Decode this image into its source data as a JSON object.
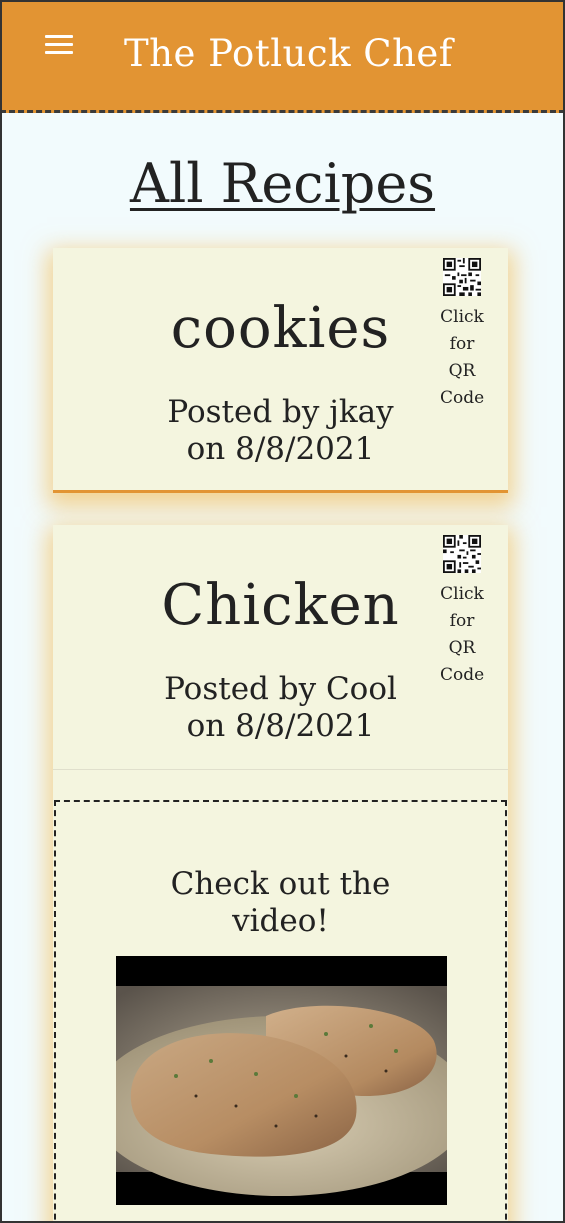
{
  "navbar": {
    "brand": "The Potluck Chef",
    "menu_icon": "hamburger-menu-icon",
    "background": "#e29433"
  },
  "page": {
    "title": "All Recipes",
    "background": "#f2fbfd"
  },
  "recipes": [
    {
      "name": "cookies",
      "posted_line1": "Posted by jkay",
      "posted_line2": "on 8/8/2021",
      "qr_label": [
        "Click",
        "for",
        "QR",
        "Code"
      ],
      "qr_icon": "qr-code-icon"
    },
    {
      "name": "Chicken",
      "posted_line1": "Posted by Cool",
      "posted_line2": "on 8/8/2021",
      "qr_label": [
        "Click",
        "for",
        "QR",
        "Code"
      ],
      "qr_icon": "qr-code-icon",
      "video_heading_line1": "Check out the",
      "video_heading_line2": "video!"
    }
  ],
  "colors": {
    "card": "#f4f5df",
    "card_glow": "#f3b23b",
    "text": "#222222"
  }
}
